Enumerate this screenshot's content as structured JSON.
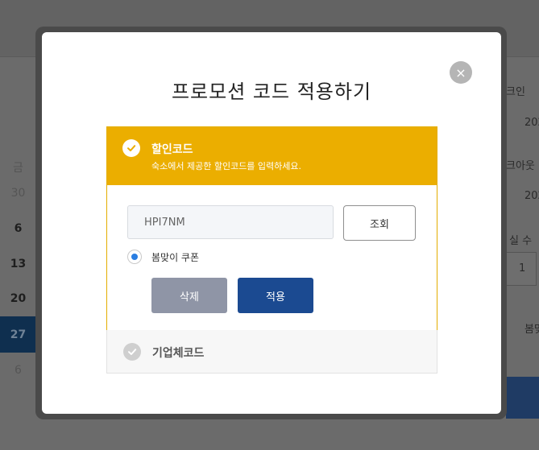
{
  "modal": {
    "title": "프로모션 코드 적용하기",
    "close_label": "×"
  },
  "discount_section": {
    "title": "할인코드",
    "description": "숙소에서 제공한 할인코드를 입력하세요.",
    "code_value": "HPI7NM",
    "lookup_label": "조회",
    "coupon_option": "봄맞이 쿠폰",
    "delete_label": "삭제",
    "apply_label": "적용"
  },
  "corporate_section": {
    "title": "기업체코드"
  },
  "background": {
    "calendar": {
      "weekday": "금",
      "days": [
        "30",
        "6",
        "13",
        "20",
        "27",
        "6"
      ]
    },
    "right_panel": {
      "checkin_fragment": "크인",
      "checkout_fragment": "크아웃",
      "year_fragment_1": "202",
      "year_fragment_2": "202",
      "count_fragment": "실 수",
      "count_value": "1",
      "coupon_fragment": "봄맞"
    }
  },
  "colors": {
    "header_yellow": "#ebae00",
    "apply_blue": "#1b4a91",
    "delete_gray": "#8f95a6"
  }
}
